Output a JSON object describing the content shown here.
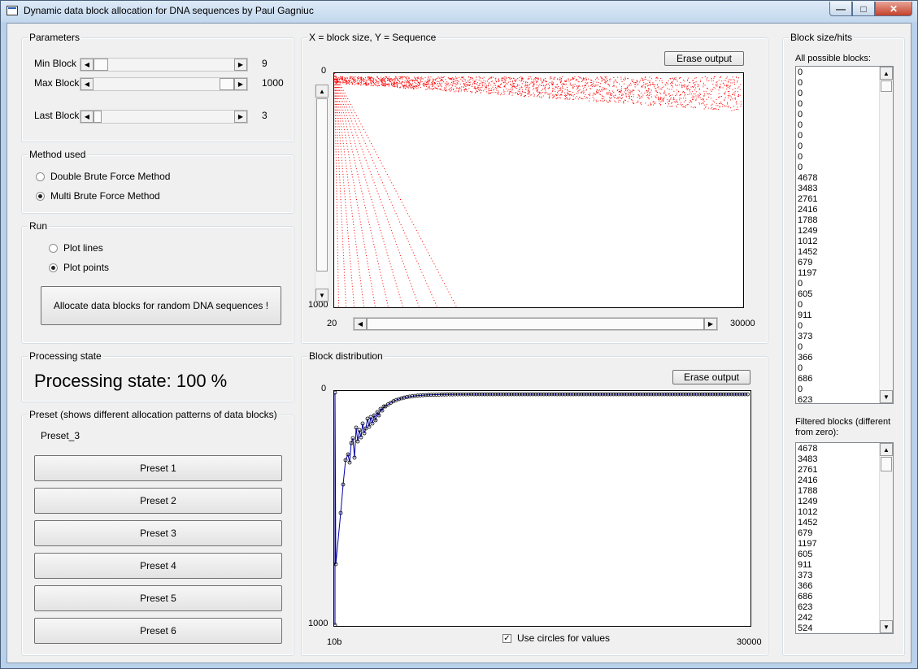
{
  "window": {
    "title": "Dynamic data block allocation for DNA sequences by Paul Gagniuc"
  },
  "parameters": {
    "label": "Parameters",
    "min_block": {
      "label": "Min Block",
      "value": "9"
    },
    "max_block": {
      "label": "Max Block",
      "value": "1000"
    },
    "last_block": {
      "label": "Last Block",
      "value": "3"
    }
  },
  "method": {
    "label": "Method used",
    "options": [
      {
        "label": "Double Brute Force Method",
        "selected": false
      },
      {
        "label": "Multi Brute Force Method",
        "selected": true
      }
    ]
  },
  "run": {
    "label": "Run",
    "options": [
      {
        "label": "Plot lines",
        "selected": false
      },
      {
        "label": "Plot points",
        "selected": true
      }
    ],
    "allocate_button": "Allocate data blocks for random DNA sequences !"
  },
  "processing": {
    "label": "Processing state",
    "text": "Processing state: 100 %"
  },
  "preset": {
    "label": "Preset (shows different allocation patterns of data blocks)",
    "current": "Preset_3",
    "buttons": [
      "Preset 1",
      "Preset 2",
      "Preset 3",
      "Preset 4",
      "Preset 5",
      "Preset 6"
    ]
  },
  "plot1": {
    "label": "X = block size, Y = Sequence",
    "erase_button": "Erase output",
    "y_top": "0",
    "y_bottom": "1000",
    "x_left": "20",
    "x_right": "30000",
    "color": "#ff0000"
  },
  "plot2": {
    "label": "Block distribution",
    "erase_button": "Erase output",
    "y_top": "0",
    "y_bottom": "1000",
    "x_left": "10b",
    "x_right": "30000",
    "checkbox_label": "Use circles for values",
    "checkbox_checked": true,
    "line_color": "#0000aa"
  },
  "block_hits": {
    "label": "Block size/hits",
    "all_label": "All possible blocks:",
    "all_items": [
      "0",
      "0",
      "0",
      "0",
      "0",
      "0",
      "0",
      "0",
      "0",
      "0",
      "4678",
      "3483",
      "2761",
      "2416",
      "1788",
      "1249",
      "1012",
      "1452",
      "679",
      "1197",
      "0",
      "605",
      "0",
      "911",
      "0",
      "373",
      "0",
      "366",
      "0",
      "686",
      "0",
      "623"
    ],
    "filtered_label": "Filtered blocks (different from zero):",
    "filtered_items": [
      "4678",
      "3483",
      "2761",
      "2416",
      "1788",
      "1249",
      "1012",
      "1452",
      "679",
      "1197",
      "605",
      "911",
      "373",
      "366",
      "686",
      "623",
      "242",
      "524"
    ]
  }
}
